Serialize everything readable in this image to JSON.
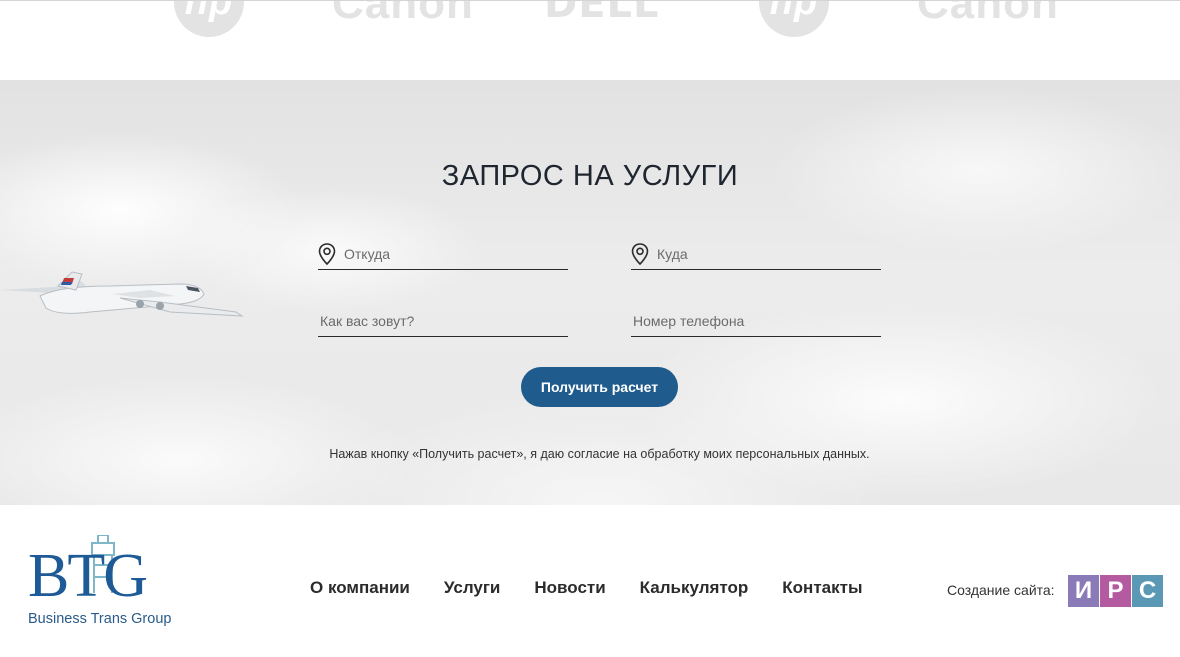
{
  "partners": [
    {
      "name": "hp",
      "text": "hp"
    },
    {
      "name": "canon",
      "text": "Canon"
    },
    {
      "name": "dell",
      "text": "DELL"
    },
    {
      "name": "hp",
      "text": "hp"
    },
    {
      "name": "canon",
      "text": "Canon"
    }
  ],
  "request": {
    "title": "ЗАПРОС НА УСЛУГИ",
    "from_placeholder": "Откуда",
    "to_placeholder": "Куда",
    "name_placeholder": "Как вас зовут?",
    "phone_placeholder": "Номер телефона",
    "submit_label": "Получить расчет",
    "consent_text": "Нажав кнопку «Получить расчет», я даю согласие на обработку моих персональных данных."
  },
  "footer": {
    "logo_letters": "BTG",
    "logo_subtitle": "Business Trans Group",
    "nav": [
      "О компании",
      "Услуги",
      "Новости",
      "Калькулятор",
      "Контакты"
    ],
    "made_by_label": "Создание сайта:",
    "studio_letters": [
      "И",
      "Р",
      "С"
    ]
  },
  "colors": {
    "button": "#1f5b8c",
    "logo_blue": "#1e5b96",
    "studio": [
      "#8a7bb8",
      "#b45aa0",
      "#5a98b6"
    ]
  },
  "icons": [
    "map-pin-icon",
    "airplane-image"
  ]
}
